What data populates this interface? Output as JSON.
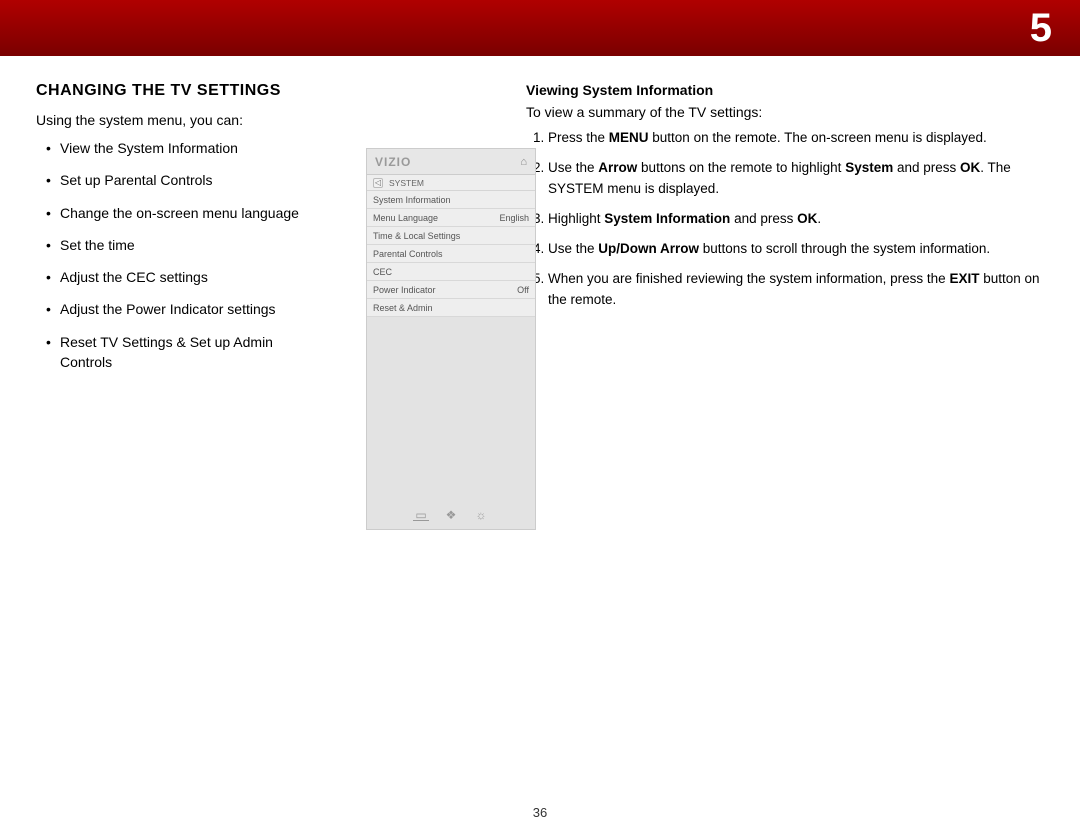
{
  "chapter_number": "5",
  "page_number": "36",
  "left": {
    "heading": "CHANGING THE TV SETTINGS",
    "intro": "Using the system menu, you can:",
    "bullets": [
      "View the System Information",
      "Set up Parental Controls",
      "Change the on-screen menu language",
      "Set the time",
      "Adjust the CEC settings",
      "Adjust the Power Indicator settings",
      "Reset TV Settings & Set up Admin Controls"
    ]
  },
  "osd": {
    "logo": "VIZIO",
    "title": "SYSTEM",
    "rows": [
      {
        "label": "System Information",
        "value": ""
      },
      {
        "label": "Menu Language",
        "value": "English"
      },
      {
        "label": "Time & Local Settings",
        "value": ""
      },
      {
        "label": "Parental Controls",
        "value": ""
      },
      {
        "label": "CEC",
        "value": ""
      },
      {
        "label": "Power Indicator",
        "value": "Off"
      },
      {
        "label": "Reset & Admin",
        "value": ""
      }
    ]
  },
  "right": {
    "subhead": "Viewing System Information",
    "intro": "To view a summary of the TV settings:",
    "steps": [
      {
        "pre": "Press the ",
        "b1": "MENU",
        "mid1": " button on the remote. The on-screen menu is displayed."
      },
      {
        "pre": "Use the ",
        "b1": "Arrow",
        "mid1": " buttons on the remote to highlight ",
        "b2": "System",
        "mid2": " and press ",
        "b3": "OK",
        "mid3": ". The SYSTEM menu is displayed."
      },
      {
        "pre": "Highlight ",
        "b1": "System Information",
        "mid1": " and press ",
        "b2": "OK",
        "mid2": "."
      },
      {
        "pre": "Use the ",
        "b1": "Up/Down Arrow",
        "mid1": " buttons to scroll through the system information."
      },
      {
        "pre": "When you are finished reviewing the system information, press the ",
        "b1": "EXIT",
        "mid1": " button on the remote."
      }
    ]
  }
}
